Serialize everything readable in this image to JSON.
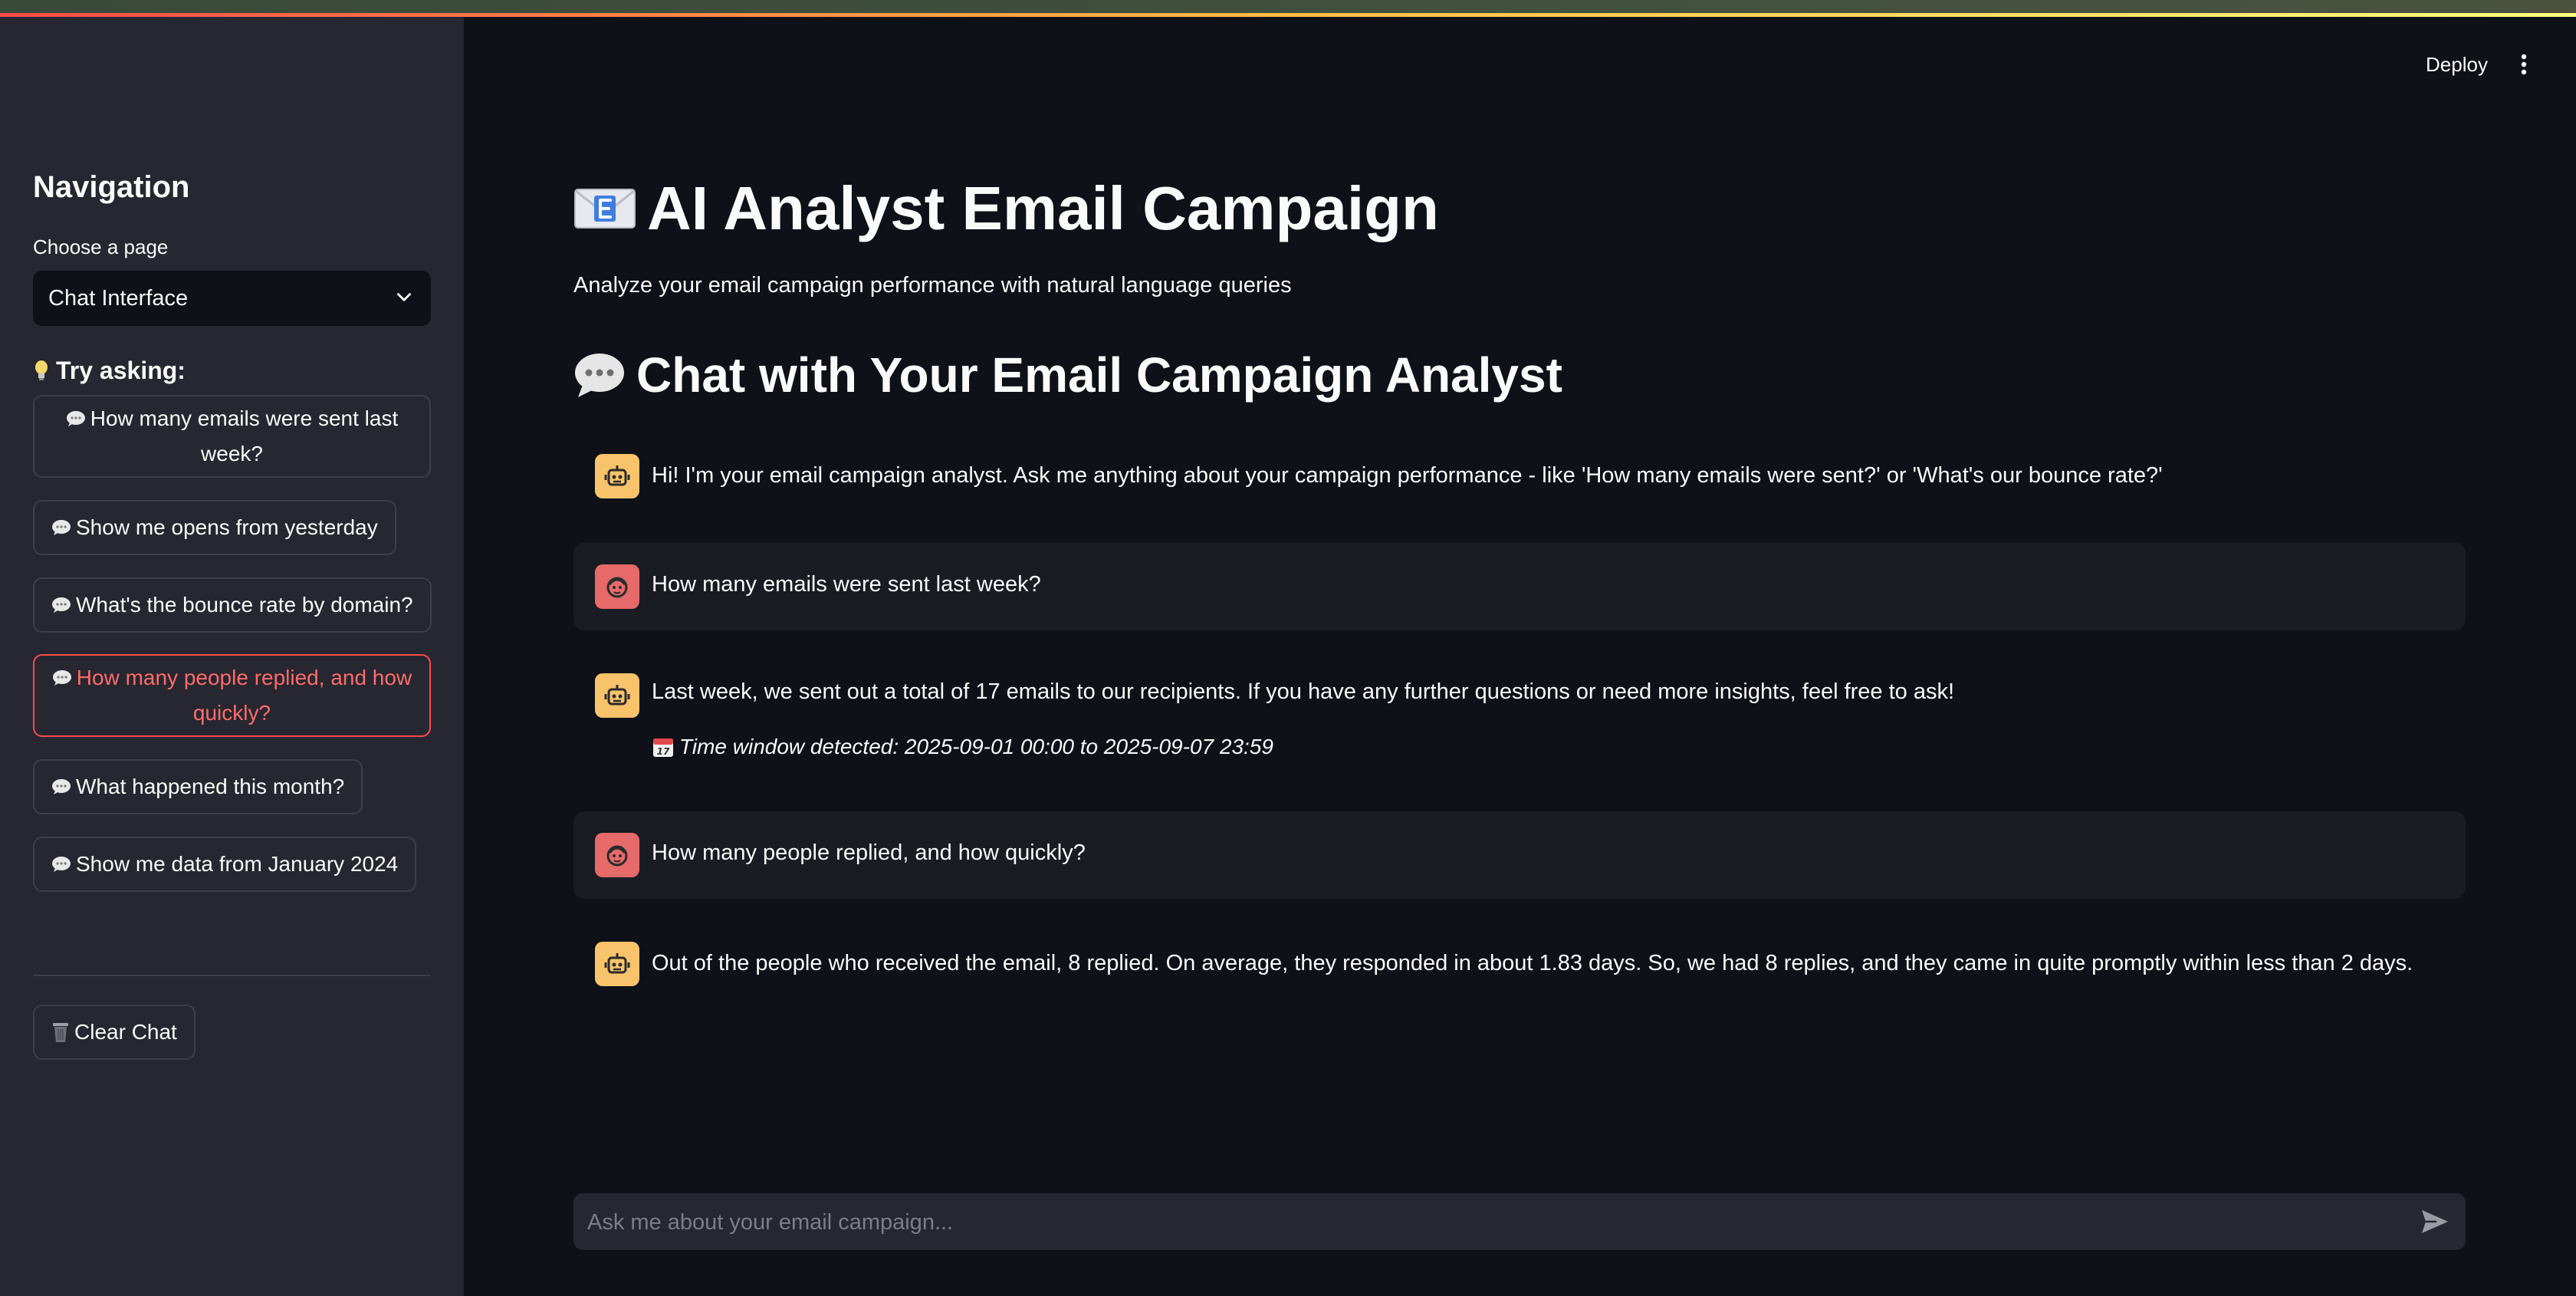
{
  "sidebar": {
    "title": "Navigation",
    "select_label": "Choose a page",
    "select_value": "Chat Interface",
    "try_title": "Try asking:",
    "suggestions": [
      {
        "line1": "How many emails were sent last",
        "line2": "week?"
      },
      {
        "line1": "Show me opens from yesterday"
      },
      {
        "line1": "What's the bounce rate by domain?"
      },
      {
        "line1": "How many people replied, and how",
        "line2": "quickly?"
      },
      {
        "line1": "What happened this month?"
      },
      {
        "line1": "Show me data from January 2024"
      }
    ],
    "clear_label": "Clear Chat"
  },
  "header": {
    "deploy_label": "Deploy"
  },
  "main": {
    "title": "AI Analyst Email Campaign",
    "subtitle": "Analyze your email campaign performance with natural language queries",
    "chat_heading": "Chat with Your Email Campaign Analyst"
  },
  "messages": [
    {
      "role": "assistant",
      "text": "Hi! I'm your email campaign analyst. Ask me anything about your campaign performance - like 'How many emails were sent?' or 'What's our bounce rate?'"
    },
    {
      "role": "user",
      "text": "How many emails were sent last week?"
    },
    {
      "role": "assistant",
      "text": "Last week, we sent out a total of 17 emails to our recipients. If you have any further questions or need more insights, feel free to ask!",
      "note": "Time window detected: 2025-09-01 00:00 to 2025-09-07 23:59"
    },
    {
      "role": "user",
      "text": "How many people replied, and how quickly?"
    },
    {
      "role": "assistant",
      "text": "Out of the people who received the email, 8 replied. On average, they responded in about 1.83 days. So, we had 8 replies, and they came in quite promptly within less than 2 days."
    }
  ],
  "chat_input": {
    "placeholder": "Ask me about your email campaign..."
  },
  "icons": {
    "title_icon": "envelope-e-icon",
    "chat_icon": "speech-bubble-icon",
    "bulb_icon": "lightbulb-icon",
    "trash_icon": "wastebasket-icon",
    "calendar_icon": "calendar-icon",
    "bot_icon": "robot-icon",
    "user_icon": "user-face-icon",
    "send_icon": "send-arrow-icon"
  },
  "colors": {
    "background": "#0e1117",
    "sidebar": "#262730",
    "accent": "#ff4b4b",
    "bot_avatar": "#f8c36b",
    "user_avatar": "#e66a6a"
  }
}
